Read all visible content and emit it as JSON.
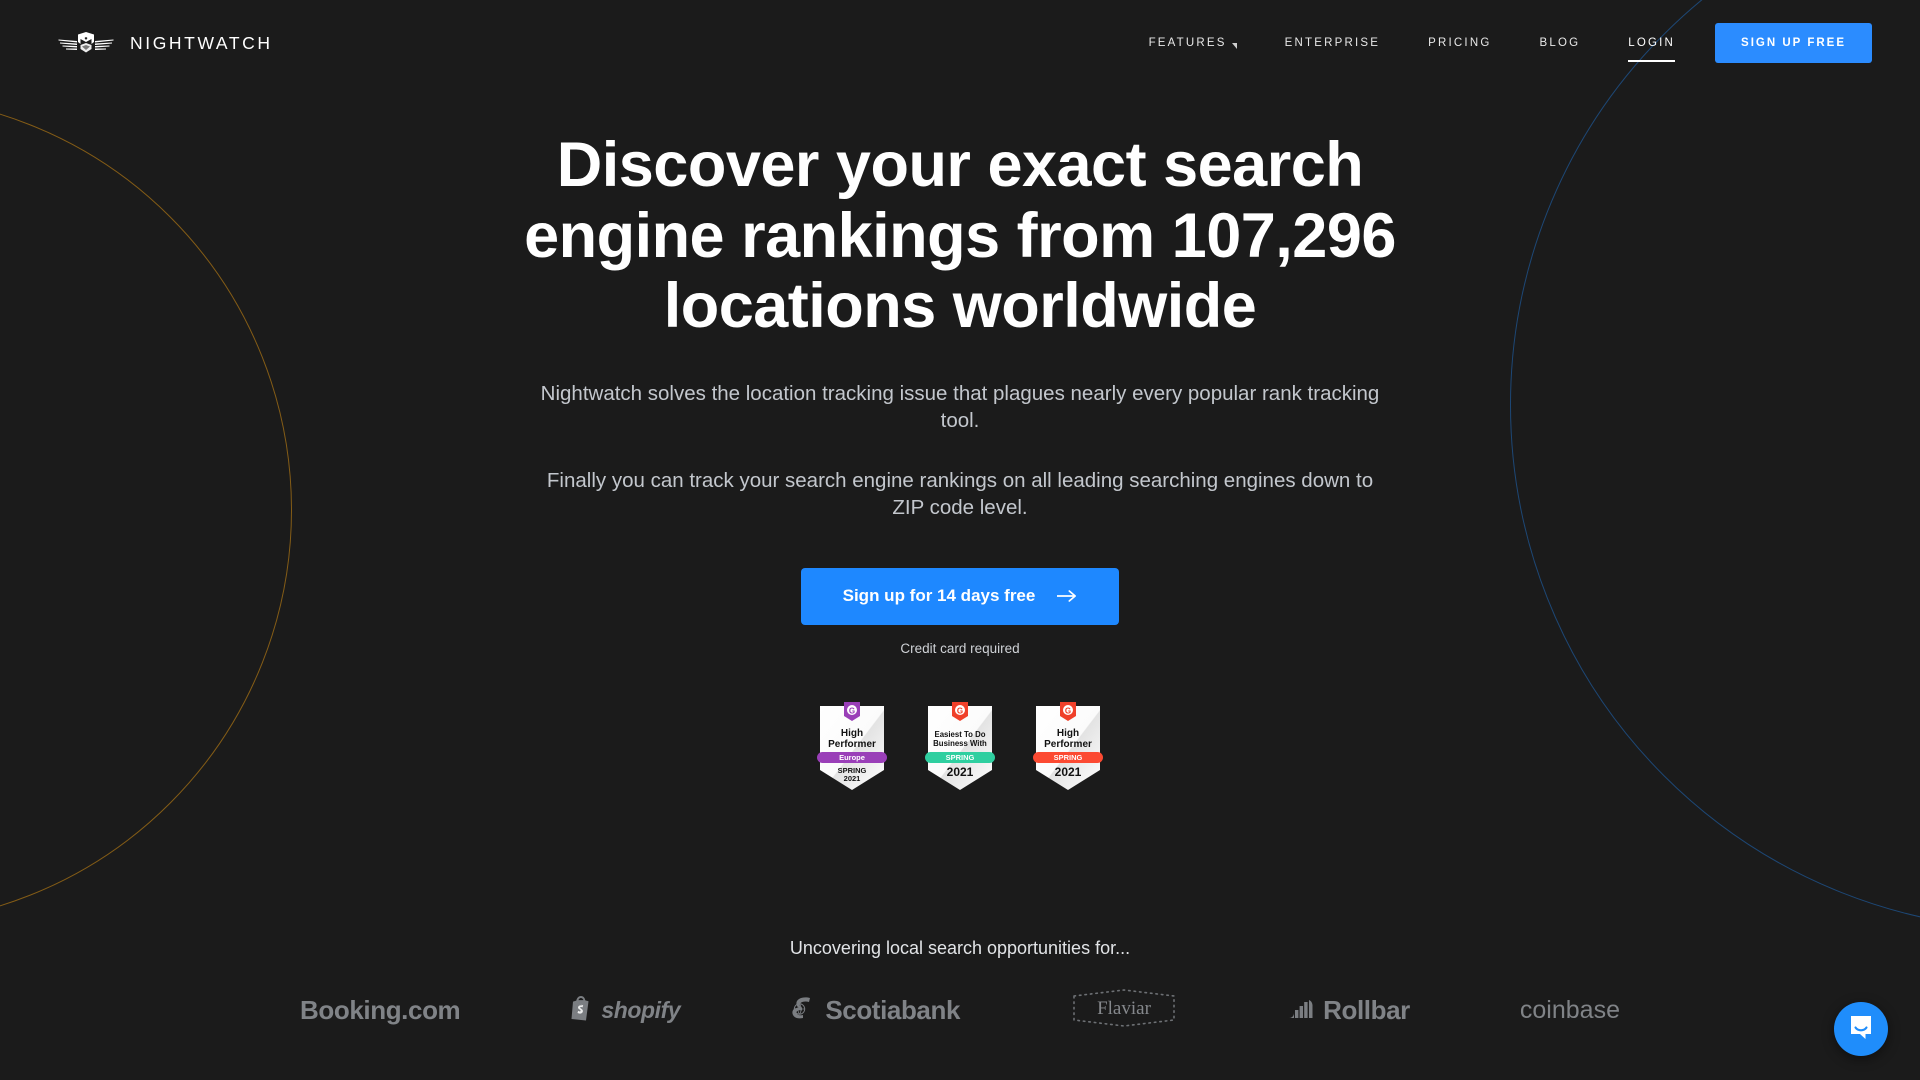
{
  "brand": {
    "name": "NIGHTWATCH",
    "logo_icon": "owl-wings-icon"
  },
  "nav": {
    "items": [
      {
        "label": "FEATURES",
        "has_dropdown": true,
        "active": false
      },
      {
        "label": "ENTERPRISE",
        "has_dropdown": false,
        "active": false
      },
      {
        "label": "PRICING",
        "has_dropdown": false,
        "active": false
      },
      {
        "label": "BLOG",
        "has_dropdown": false,
        "active": false
      },
      {
        "label": "LOGIN",
        "has_dropdown": false,
        "active": true
      }
    ],
    "cta_label": "SIGN UP FREE"
  },
  "hero": {
    "headline": "Discover your exact search engine rankings from 107,296 locations worldwide",
    "paragraph_1": "Nightwatch solves the location tracking issue that plagues nearly every popular rank tracking tool.",
    "paragraph_2": "Finally you can track your search engine rankings on all leading searching engines down to ZIP code level.",
    "cta_label": "Sign up for 14 days free",
    "cta_icon": "arrow-right-icon",
    "cta_note": "Credit card required"
  },
  "badges": [
    {
      "vendor": "G2",
      "title_line_1": "High",
      "title_line_2": "Performer",
      "band_label": "Europe",
      "band_color": "#9a3fb8",
      "ribbon_color": "#9a3fb8",
      "footer_line_1": "SPRING",
      "footer_line_2": "2021",
      "year": ""
    },
    {
      "vendor": "G2",
      "title_line_1": "Easiest To Do",
      "title_line_2": "Business With",
      "band_label": "SPRING",
      "band_color": "#2fcfa0",
      "ribbon_color": "#f0402a",
      "footer_line_1": "",
      "footer_line_2": "",
      "year": "2021"
    },
    {
      "vendor": "G2",
      "title_line_1": "High",
      "title_line_2": "Performer",
      "band_label": "SPRING",
      "band_color": "#fc4a32",
      "ribbon_color": "#f0402a",
      "footer_line_1": "",
      "footer_line_2": "",
      "year": "2021"
    }
  ],
  "clients": {
    "title": "Uncovering local search opportunities for...",
    "logos": [
      {
        "name": "Booking.com",
        "icon": ""
      },
      {
        "name": "shopify",
        "icon": "shopping-bag-icon"
      },
      {
        "name": "Scotiabank",
        "icon": "scotiabank-globe-icon"
      },
      {
        "name": "Flaviar",
        "icon": "dotted-hexagon-frame"
      },
      {
        "name": "Rollbar",
        "icon": "bar-chart-icon"
      },
      {
        "name": "coinbase",
        "icon": ""
      }
    ]
  },
  "chat_widget": {
    "icon": "chat-bubble-smile-icon",
    "color": "#1f8dfb"
  },
  "theme": {
    "background": "#1b1b1b",
    "accent_blue": "#1e88ff",
    "arc_gold": "#8a6016",
    "arc_blue": "#1d4a7a",
    "muted_text": "#c3c7cd",
    "logo_grey": "#808387"
  }
}
